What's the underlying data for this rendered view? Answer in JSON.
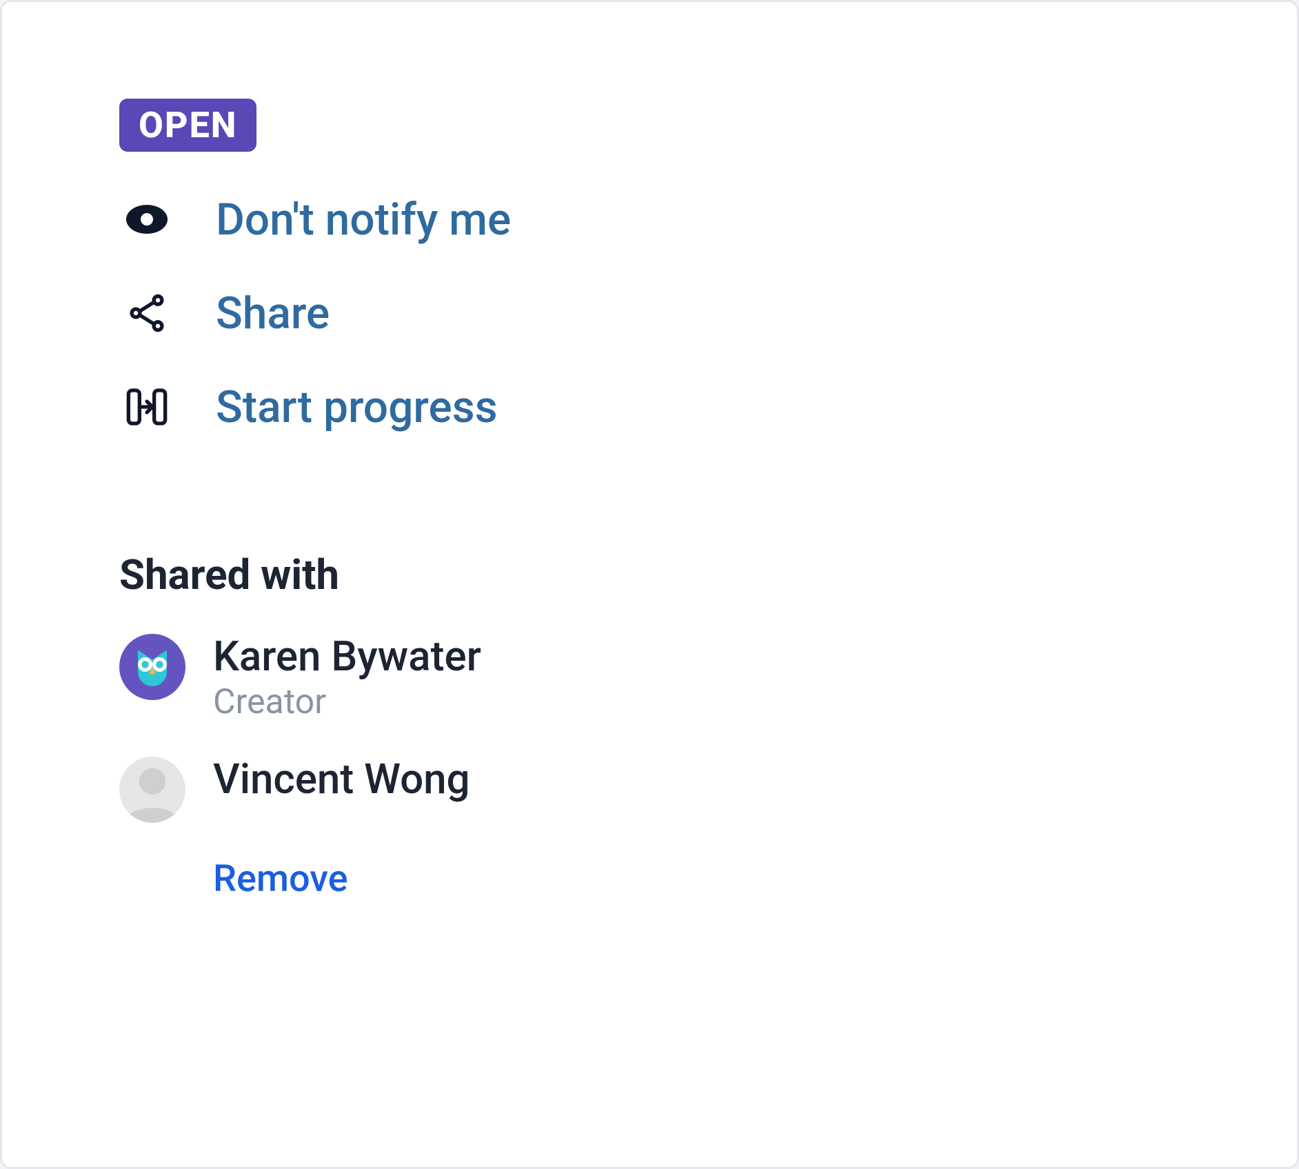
{
  "status": {
    "label": "OPEN"
  },
  "actions": {
    "notify": {
      "label": "Don't notify me"
    },
    "share": {
      "label": "Share"
    },
    "start_progress": {
      "label": "Start progress"
    }
  },
  "shared_with": {
    "heading": "Shared with",
    "people": [
      {
        "name": "Karen Bywater",
        "role": "Creator"
      },
      {
        "name": "Vincent Wong"
      }
    ],
    "remove_label": "Remove"
  }
}
